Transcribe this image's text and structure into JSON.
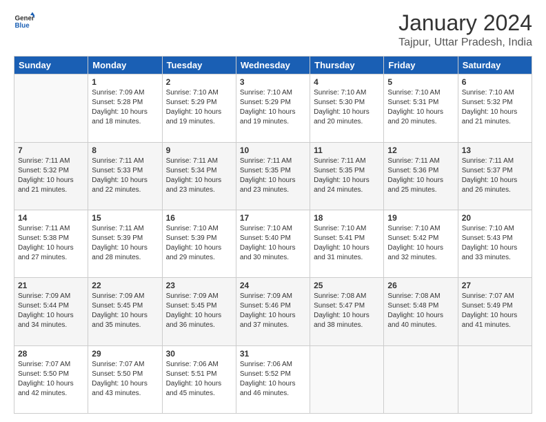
{
  "logo": {
    "line1": "General",
    "line2": "Blue"
  },
  "title": "January 2024",
  "subtitle": "Tajpur, Uttar Pradesh, India",
  "days_header": [
    "Sunday",
    "Monday",
    "Tuesday",
    "Wednesday",
    "Thursday",
    "Friday",
    "Saturday"
  ],
  "weeks": [
    [
      {
        "num": "",
        "info": ""
      },
      {
        "num": "1",
        "info": "Sunrise: 7:09 AM\nSunset: 5:28 PM\nDaylight: 10 hours\nand 18 minutes."
      },
      {
        "num": "2",
        "info": "Sunrise: 7:10 AM\nSunset: 5:29 PM\nDaylight: 10 hours\nand 19 minutes."
      },
      {
        "num": "3",
        "info": "Sunrise: 7:10 AM\nSunset: 5:29 PM\nDaylight: 10 hours\nand 19 minutes."
      },
      {
        "num": "4",
        "info": "Sunrise: 7:10 AM\nSunset: 5:30 PM\nDaylight: 10 hours\nand 20 minutes."
      },
      {
        "num": "5",
        "info": "Sunrise: 7:10 AM\nSunset: 5:31 PM\nDaylight: 10 hours\nand 20 minutes."
      },
      {
        "num": "6",
        "info": "Sunrise: 7:10 AM\nSunset: 5:32 PM\nDaylight: 10 hours\nand 21 minutes."
      }
    ],
    [
      {
        "num": "7",
        "info": "Sunrise: 7:11 AM\nSunset: 5:32 PM\nDaylight: 10 hours\nand 21 minutes."
      },
      {
        "num": "8",
        "info": "Sunrise: 7:11 AM\nSunset: 5:33 PM\nDaylight: 10 hours\nand 22 minutes."
      },
      {
        "num": "9",
        "info": "Sunrise: 7:11 AM\nSunset: 5:34 PM\nDaylight: 10 hours\nand 23 minutes."
      },
      {
        "num": "10",
        "info": "Sunrise: 7:11 AM\nSunset: 5:35 PM\nDaylight: 10 hours\nand 23 minutes."
      },
      {
        "num": "11",
        "info": "Sunrise: 7:11 AM\nSunset: 5:35 PM\nDaylight: 10 hours\nand 24 minutes."
      },
      {
        "num": "12",
        "info": "Sunrise: 7:11 AM\nSunset: 5:36 PM\nDaylight: 10 hours\nand 25 minutes."
      },
      {
        "num": "13",
        "info": "Sunrise: 7:11 AM\nSunset: 5:37 PM\nDaylight: 10 hours\nand 26 minutes."
      }
    ],
    [
      {
        "num": "14",
        "info": "Sunrise: 7:11 AM\nSunset: 5:38 PM\nDaylight: 10 hours\nand 27 minutes."
      },
      {
        "num": "15",
        "info": "Sunrise: 7:11 AM\nSunset: 5:39 PM\nDaylight: 10 hours\nand 28 minutes."
      },
      {
        "num": "16",
        "info": "Sunrise: 7:10 AM\nSunset: 5:39 PM\nDaylight: 10 hours\nand 29 minutes."
      },
      {
        "num": "17",
        "info": "Sunrise: 7:10 AM\nSunset: 5:40 PM\nDaylight: 10 hours\nand 30 minutes."
      },
      {
        "num": "18",
        "info": "Sunrise: 7:10 AM\nSunset: 5:41 PM\nDaylight: 10 hours\nand 31 minutes."
      },
      {
        "num": "19",
        "info": "Sunrise: 7:10 AM\nSunset: 5:42 PM\nDaylight: 10 hours\nand 32 minutes."
      },
      {
        "num": "20",
        "info": "Sunrise: 7:10 AM\nSunset: 5:43 PM\nDaylight: 10 hours\nand 33 minutes."
      }
    ],
    [
      {
        "num": "21",
        "info": "Sunrise: 7:09 AM\nSunset: 5:44 PM\nDaylight: 10 hours\nand 34 minutes."
      },
      {
        "num": "22",
        "info": "Sunrise: 7:09 AM\nSunset: 5:45 PM\nDaylight: 10 hours\nand 35 minutes."
      },
      {
        "num": "23",
        "info": "Sunrise: 7:09 AM\nSunset: 5:45 PM\nDaylight: 10 hours\nand 36 minutes."
      },
      {
        "num": "24",
        "info": "Sunrise: 7:09 AM\nSunset: 5:46 PM\nDaylight: 10 hours\nand 37 minutes."
      },
      {
        "num": "25",
        "info": "Sunrise: 7:08 AM\nSunset: 5:47 PM\nDaylight: 10 hours\nand 38 minutes."
      },
      {
        "num": "26",
        "info": "Sunrise: 7:08 AM\nSunset: 5:48 PM\nDaylight: 10 hours\nand 40 minutes."
      },
      {
        "num": "27",
        "info": "Sunrise: 7:07 AM\nSunset: 5:49 PM\nDaylight: 10 hours\nand 41 minutes."
      }
    ],
    [
      {
        "num": "28",
        "info": "Sunrise: 7:07 AM\nSunset: 5:50 PM\nDaylight: 10 hours\nand 42 minutes."
      },
      {
        "num": "29",
        "info": "Sunrise: 7:07 AM\nSunset: 5:50 PM\nDaylight: 10 hours\nand 43 minutes."
      },
      {
        "num": "30",
        "info": "Sunrise: 7:06 AM\nSunset: 5:51 PM\nDaylight: 10 hours\nand 45 minutes."
      },
      {
        "num": "31",
        "info": "Sunrise: 7:06 AM\nSunset: 5:52 PM\nDaylight: 10 hours\nand 46 minutes."
      },
      {
        "num": "",
        "info": ""
      },
      {
        "num": "",
        "info": ""
      },
      {
        "num": "",
        "info": ""
      }
    ]
  ]
}
